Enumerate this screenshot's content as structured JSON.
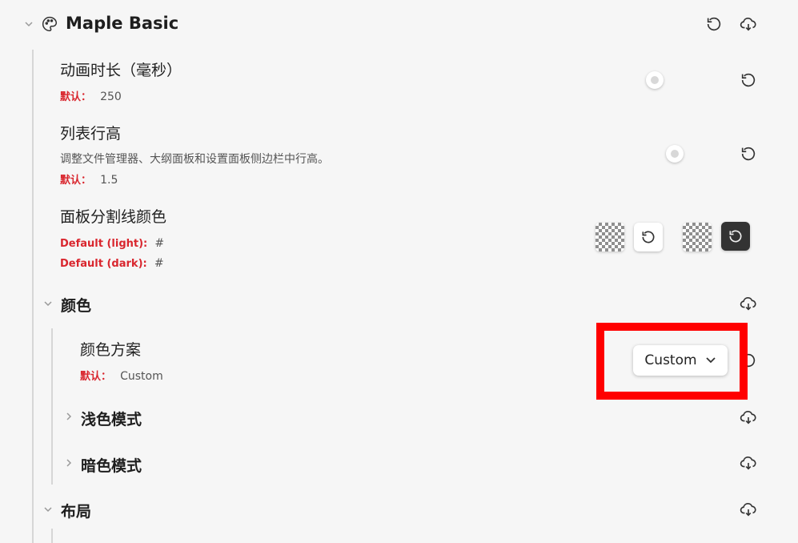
{
  "section": {
    "title": "Maple Basic"
  },
  "settings": [
    {
      "name": "动画时长（毫秒）",
      "default_label": "默认：",
      "default_value": "250"
    },
    {
      "name": "列表行高",
      "description": "调整文件管理器、大纲面板和设置面板侧边栏中行高。",
      "default_label": "默认：",
      "default_value": "1.5"
    },
    {
      "name": "面板分割线颜色",
      "default_light_label": "Default (light):",
      "default_light_value": "#",
      "default_dark_label": "Default (dark):",
      "default_dark_value": "#"
    }
  ],
  "color_section": {
    "title": "颜色",
    "scheme": {
      "name": "颜色方案",
      "default_label": "默认：",
      "default_value": "Custom",
      "selected": "Custom"
    },
    "light_mode": "浅色模式",
    "dark_mode": "暗色模式"
  },
  "layout_section": {
    "title": "布局"
  },
  "colors": {
    "accent_red": "#d9262e",
    "highlight": "#ff0000"
  },
  "icons": [
    "palette-icon",
    "reset-icon",
    "download-icon",
    "chevron-down-icon",
    "chevron-right-icon"
  ]
}
